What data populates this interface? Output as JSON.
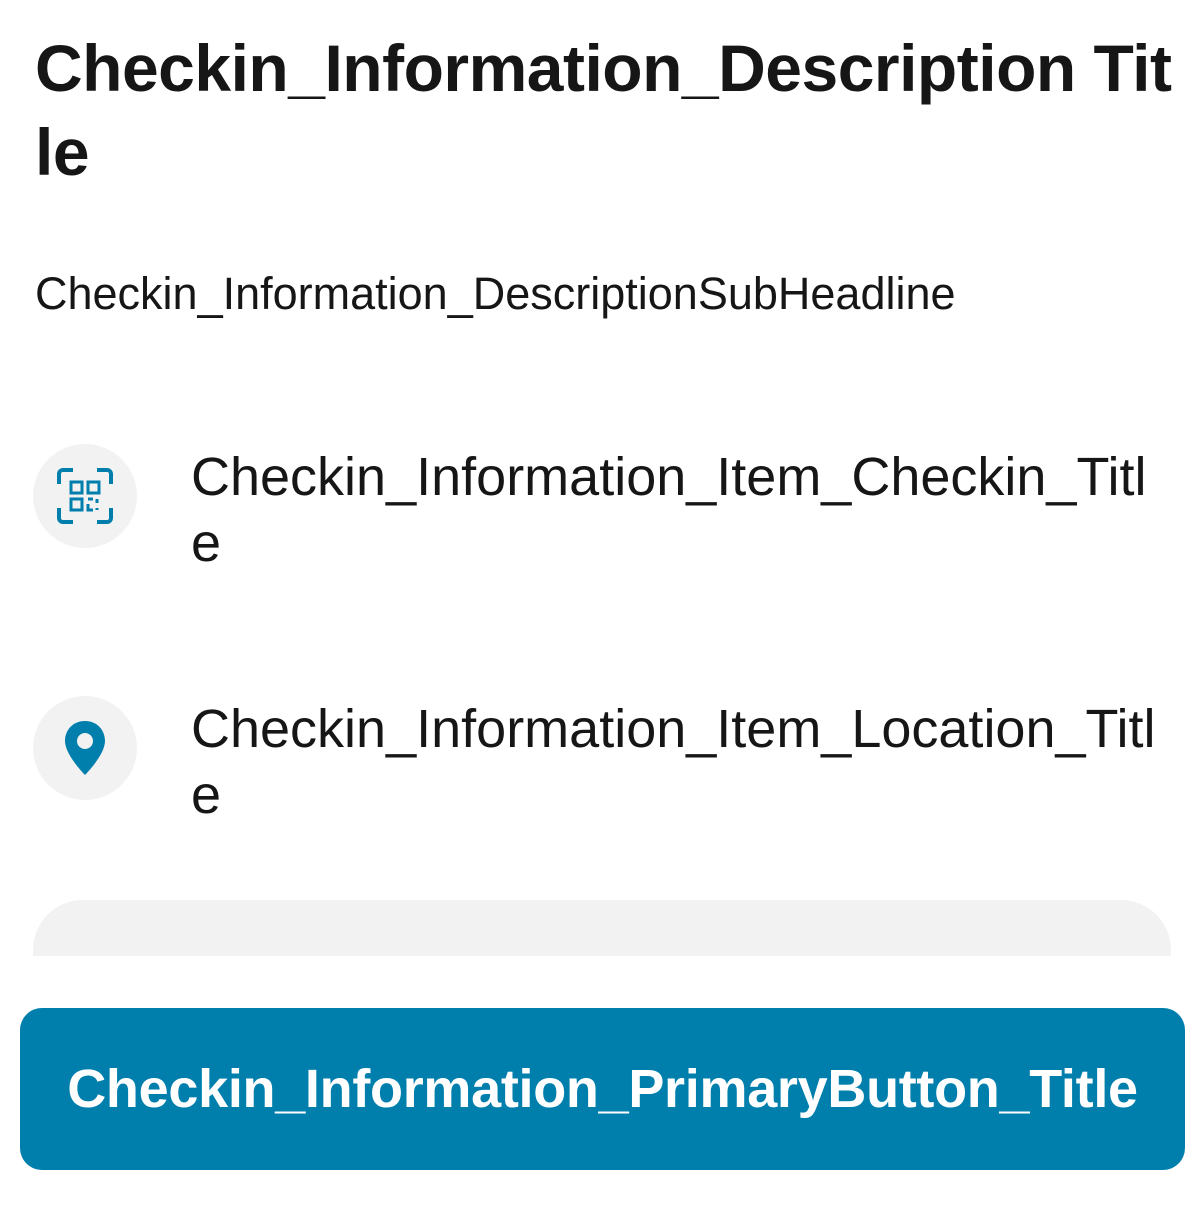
{
  "header": {
    "title": "Checkin_Information_Description Title",
    "subheadline": "Checkin_Information_DescriptionSubHeadline"
  },
  "items": [
    {
      "icon": "qr-scan-icon",
      "title": "Checkin_Information_Item_Checkin_Title"
    },
    {
      "icon": "location-pin-icon",
      "title": "Checkin_Information_Item_Location_Title"
    }
  ],
  "footer": {
    "primary_button_label": "Checkin_Information_PrimaryButton_Title"
  },
  "colors": {
    "accent": "#007fad",
    "text": "#161616",
    "icon_background": "#f2f2f2"
  }
}
